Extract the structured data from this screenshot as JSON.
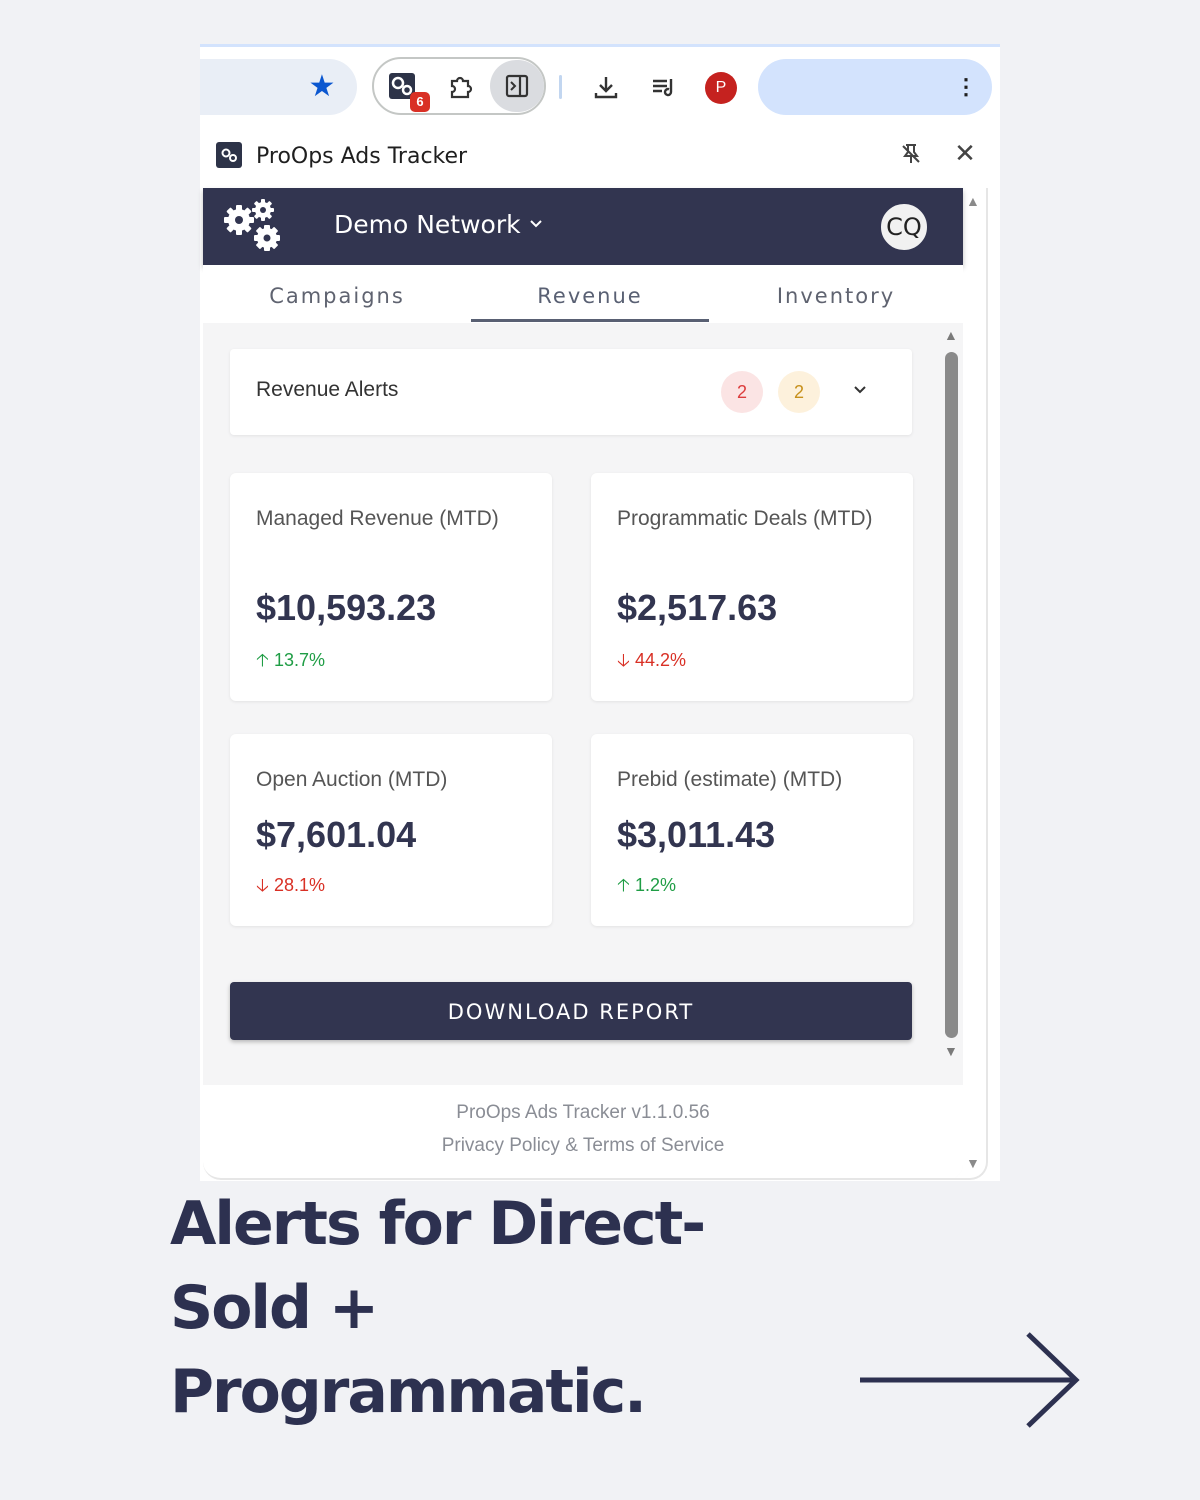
{
  "browser": {
    "extension_badge": "6",
    "profile_initial": "P",
    "menu_glyph": "⋮",
    "star_glyph": "★"
  },
  "side_panel": {
    "title": "ProOps Ads Tracker",
    "pin_glyph": "✕",
    "close_glyph": "✕"
  },
  "app": {
    "network_name": "Demo Network",
    "avatar_initials": "CQ",
    "tabs": [
      {
        "label": "Campaigns",
        "active": false
      },
      {
        "label": "Revenue",
        "active": true
      },
      {
        "label": "Inventory",
        "active": false
      }
    ],
    "alerts": {
      "title": "Revenue Alerts",
      "critical_count": "2",
      "warning_count": "2"
    },
    "metrics": [
      {
        "label": "Managed Revenue (MTD)",
        "value": "$10,593.23",
        "delta": "13.7%",
        "direction": "up"
      },
      {
        "label": "Programmatic Deals (MTD)",
        "value": "$2,517.63",
        "delta": "44.2%",
        "direction": "down"
      },
      {
        "label": "Open Auction (MTD)",
        "value": "$7,601.04",
        "delta": "28.1%",
        "direction": "down"
      },
      {
        "label": "Prebid (estimate) (MTD)",
        "value": "$3,011.43",
        "delta": "1.2%",
        "direction": "up"
      }
    ],
    "download_label": "DOWNLOAD REPORT",
    "footer": {
      "version": "ProOps Ads Tracker v1.1.0.56",
      "links": "Privacy Policy & Terms of Service"
    }
  },
  "caption": {
    "line1": "Alerts for Direct-",
    "line2": "Sold +",
    "line3": "Programmatic."
  },
  "colors": {
    "brand_navy": "#323550",
    "up_green": "#1f9d45",
    "down_red": "#d93025",
    "chrome_blue": "#d3e3fd"
  }
}
